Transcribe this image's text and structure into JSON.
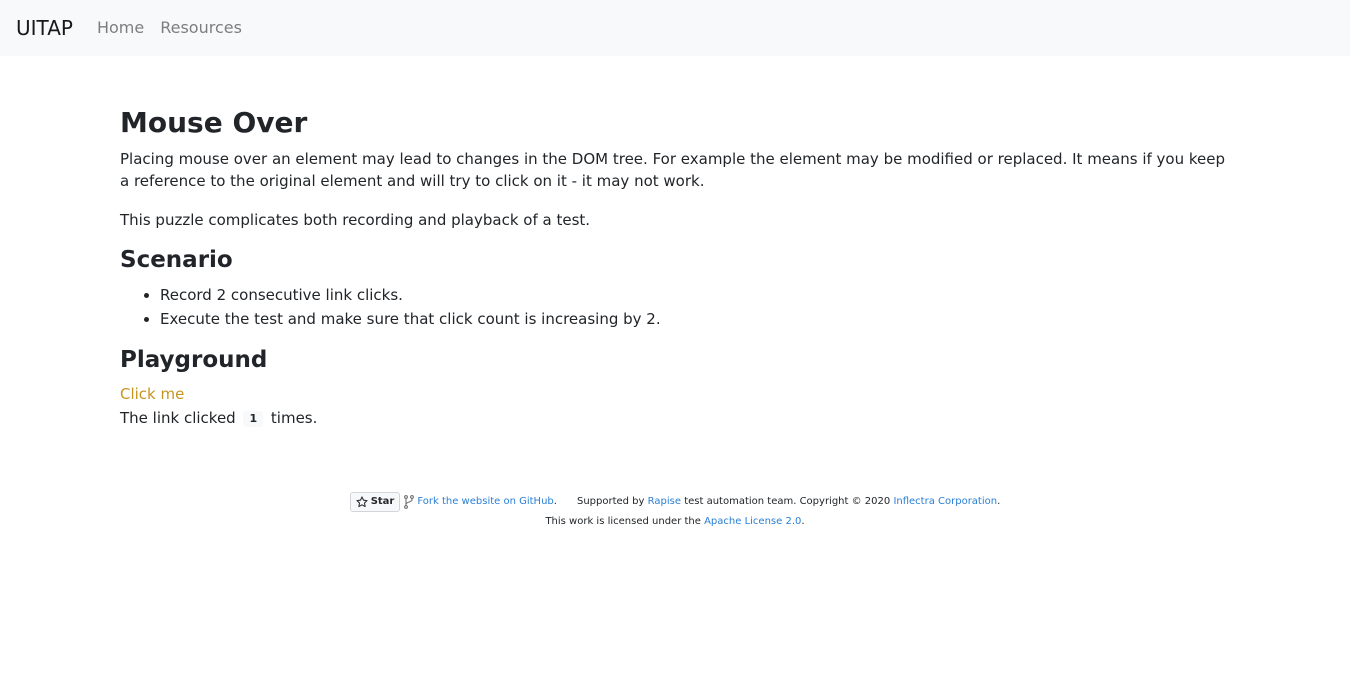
{
  "navbar": {
    "brand": "UITAP",
    "links": [
      "Home",
      "Resources"
    ]
  },
  "main": {
    "title": "Mouse Over",
    "intro": "Placing mouse over an element may lead to changes in the DOM tree. For example the element may be modified or replaced. It means if you keep a reference to the original element and will try to click on it - it may not work.",
    "note": "This puzzle complicates both recording and playback of a test.",
    "scenario_title": "Scenario",
    "scenario_items": [
      "Record 2 consecutive link clicks.",
      "Execute the test and make sure that click count is increasing by 2."
    ],
    "playground_title": "Playground",
    "click_link": "Click me",
    "counter_prefix": "The link clicked",
    "counter_value": "1",
    "counter_suffix": "times."
  },
  "footer": {
    "star_label": "Star",
    "fork_link": "Fork the website on GitHub",
    "fork_end": ".",
    "supported_by": "Supported by",
    "rapise": "Rapise",
    "team_text": "test automation team. Copyright © 2020",
    "inflectra": "Inflectra Corporation",
    "inflectra_end": ".",
    "license_text": "This work is licensed under the",
    "license_link": "Apache License 2.0",
    "license_end": "."
  },
  "colors": {
    "navbar_bg": "#f8f9fa",
    "link_accent": "#c6951f",
    "footer_link": "#2a7fd4"
  }
}
